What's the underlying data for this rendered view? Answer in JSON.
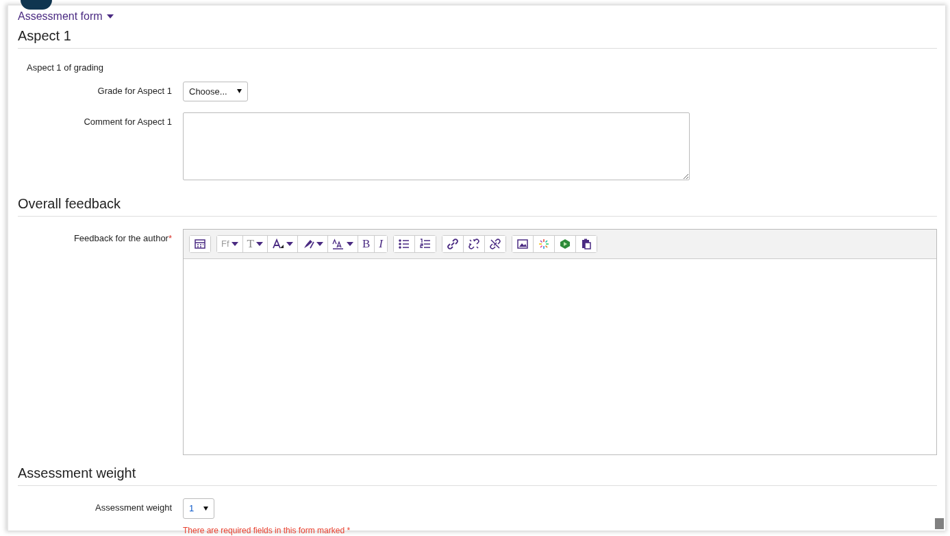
{
  "section_toggle": {
    "label": "Assessment form",
    "expanded": true
  },
  "aspect": {
    "heading": "Aspect 1",
    "description": "Aspect 1 of grading",
    "grade_label": "Grade for Aspect 1",
    "grade_value": "Choose...",
    "comment_label": "Comment for Aspect 1"
  },
  "feedback": {
    "heading": "Overall feedback",
    "label": "Feedback for the author",
    "required_mark": "*",
    "toolbar": [
      [
        {
          "kind": "grid"
        }
      ],
      [
        {
          "kind": "font",
          "glyph": "Ff",
          "dropdown": true
        },
        {
          "kind": "size",
          "glyph": "T",
          "dropdown": true
        },
        {
          "kind": "color",
          "dropdown": true
        },
        {
          "kind": "highlight",
          "dropdown": true
        },
        {
          "kind": "lang",
          "dropdown": true
        },
        {
          "kind": "bold",
          "glyph": "B"
        },
        {
          "kind": "italic",
          "glyph": "I"
        }
      ],
      [
        {
          "kind": "bullets"
        },
        {
          "kind": "numbers"
        }
      ],
      [
        {
          "kind": "link"
        },
        {
          "kind": "unlink"
        },
        {
          "kind": "nolink"
        }
      ],
      [
        {
          "kind": "image"
        },
        {
          "kind": "media"
        },
        {
          "kind": "record"
        },
        {
          "kind": "paste"
        }
      ]
    ]
  },
  "weight": {
    "heading": "Assessment weight",
    "label": "Assessment weight",
    "value": "1"
  },
  "required_note": "There are required fields in this form marked *"
}
